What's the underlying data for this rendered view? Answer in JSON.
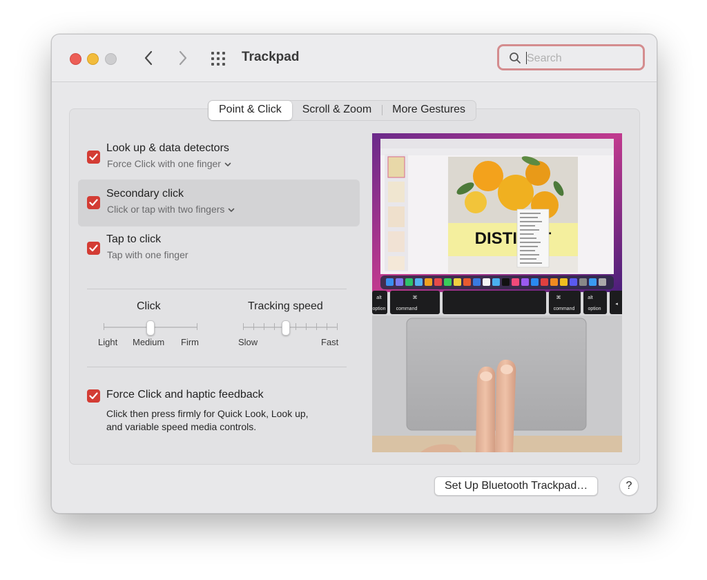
{
  "window": {
    "title": "Trackpad"
  },
  "search": {
    "placeholder": "Search",
    "value": ""
  },
  "tabs": [
    {
      "label": "Point & Click",
      "active": true
    },
    {
      "label": "Scroll & Zoom",
      "active": false
    },
    {
      "label": "More Gestures",
      "active": false
    }
  ],
  "options": [
    {
      "title": "Look up & data detectors",
      "subtitle": "Force Click with one finger",
      "checked": true,
      "has_dropdown": true,
      "selected": false
    },
    {
      "title": "Secondary click",
      "subtitle": "Click or tap with two fingers",
      "checked": true,
      "has_dropdown": true,
      "selected": true
    },
    {
      "title": "Tap to click",
      "subtitle": "Tap with one finger",
      "checked": true,
      "has_dropdown": false,
      "selected": false
    }
  ],
  "click_slider": {
    "label": "Click",
    "stops": [
      "Light",
      "Medium",
      "Firm"
    ],
    "value": "Medium"
  },
  "tracking_slider": {
    "label": "Tracking speed",
    "min_label": "Slow",
    "max_label": "Fast",
    "ticks": 10,
    "value_fraction": 0.45
  },
  "force_click": {
    "title": "Force Click and haptic feedback",
    "desc_line1": "Click then press firmly for Quick Look, Look up,",
    "desc_line2": "and variable speed media controls.",
    "checked": true
  },
  "preview": {
    "slide_title": "DISTINCT",
    "keyboard": [
      "alt",
      "option",
      "⌘",
      "command",
      "⌘",
      "command",
      "alt",
      "option"
    ]
  },
  "footer": {
    "setup_button": "Set Up Bluetooth Trackpad…",
    "help_button": "?"
  },
  "colors": {
    "accent_red": "#d33c34",
    "search_focus": "#d48c8e",
    "window_bg": "#e8e8ea"
  }
}
